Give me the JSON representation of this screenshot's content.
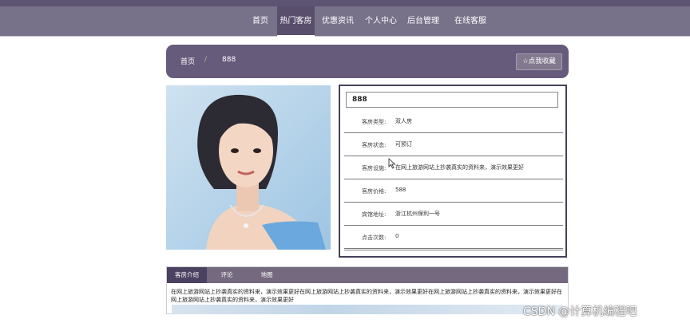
{
  "nav": {
    "items": [
      {
        "label": "首页"
      },
      {
        "label": "热门客房"
      },
      {
        "label": "优惠资讯"
      },
      {
        "label": "个人中心"
      },
      {
        "label": "后台管理"
      },
      {
        "label": "在线客服"
      }
    ],
    "active_index": 1
  },
  "breadcrumb": {
    "home": "首页",
    "separator": "/",
    "current": "888"
  },
  "favorite_button": {
    "icon": "star-icon",
    "label": "☆点我收藏"
  },
  "room": {
    "title": "888",
    "fields": [
      {
        "label": "客房类型:",
        "value": "双人房"
      },
      {
        "label": "客房状态:",
        "value": "可预订"
      },
      {
        "label": "客房设施:",
        "value": "在网上旅游网站上抄袭真实的资料来，演示效果更好"
      },
      {
        "label": "客房价格:",
        "value": "588"
      },
      {
        "label": "宾馆地址:",
        "value": "浙江杭州保利一号"
      },
      {
        "label": "点击次数:",
        "value": "0"
      }
    ]
  },
  "tabs": {
    "items": [
      {
        "label": "客房介绍"
      },
      {
        "label": "评论"
      },
      {
        "label": "地图"
      }
    ],
    "active_index": 0,
    "content": "在网上旅游网站上抄袭真实的资料来，演示效果更好在网上旅游网站上抄袭真实的资料来，演示效果更好在网上旅游网站上抄袭真实的资料来，演示效果更好在网上旅游网站上抄袭真实的资料来，演示效果更好"
  },
  "watermark": "CSDN @计算机编程吧",
  "colors": {
    "nav_bg": "#77718a",
    "nav_active": "#5a4e6d",
    "header_bar": "#675b7c",
    "tab_bar": "#74697f",
    "tab_active": "#4b4160",
    "box_border": "#47405a"
  }
}
